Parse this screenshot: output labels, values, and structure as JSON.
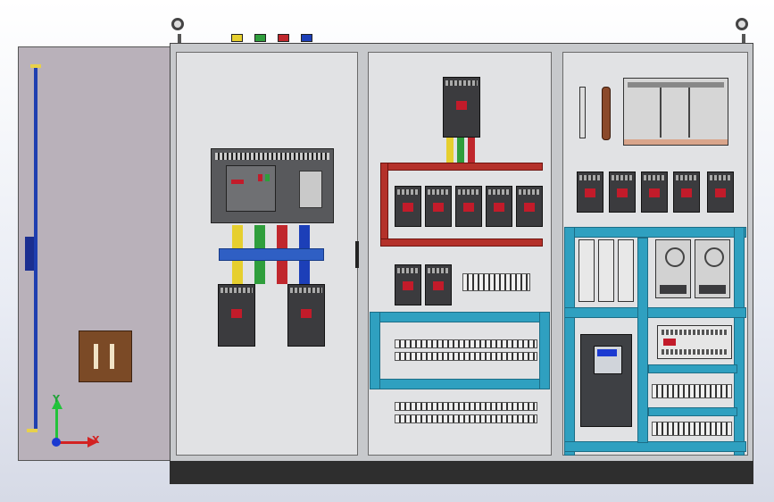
{
  "viewport": {
    "title": ""
  },
  "axes": {
    "x_label": "X",
    "y_label": "Y"
  },
  "colors": {
    "phase_l1": "#e6cf2e",
    "phase_l2": "#2f9e3c",
    "phase_l3": "#c0272d",
    "neutral": "#1c3fb8",
    "busbar": "#b4312a",
    "din_rail": "#2fa0c0",
    "door": "#b9b1ba",
    "cabinet": "#c7c9cc"
  },
  "components": {
    "acb_label": "",
    "vfd_label": ""
  }
}
